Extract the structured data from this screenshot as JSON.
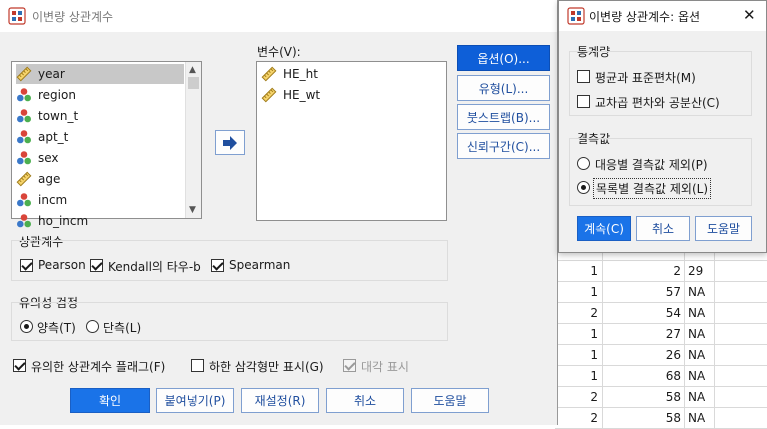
{
  "main_dialog": {
    "title": "이변량 상관계수",
    "variables_label": "변수(V):",
    "source_list": [
      {
        "name": "year",
        "type": "scale",
        "selected": true
      },
      {
        "name": "region",
        "type": "nominal"
      },
      {
        "name": "town_t",
        "type": "nominal"
      },
      {
        "name": "apt_t",
        "type": "nominal"
      },
      {
        "name": "sex",
        "type": "nominal"
      },
      {
        "name": "age",
        "type": "scale"
      },
      {
        "name": "incm",
        "type": "nominal"
      },
      {
        "name": "ho_incm",
        "type": "nominal"
      }
    ],
    "target_list": [
      {
        "name": "HE_ht",
        "type": "scale"
      },
      {
        "name": "HE_wt",
        "type": "scale"
      }
    ],
    "side_buttons": [
      "옵션(O)...",
      "유형(L)...",
      "붓스트랩(B)...",
      "신뢰구간(C)..."
    ],
    "correlation_group": {
      "title": "상관계수",
      "pearson": "Pearson",
      "kendall": "Kendall의 타우-b",
      "spearman": "Spearman"
    },
    "significance_group": {
      "title": "유의성 검정",
      "two_tailed": "양측(T)",
      "one_tailed": "단측(L)"
    },
    "flag_label": "유의한 상관계수 플래그(F)",
    "lower_triangle_label": "하한 삼각형만 표시(G)",
    "diagonal_label": "대각 표시",
    "bottom_buttons": [
      "확인",
      "붙여넣기(P)",
      "재설정(R)",
      "취소",
      "도움말"
    ]
  },
  "options_dialog": {
    "title": "이변량 상관계수: 옵션",
    "close_glyph": "✕",
    "stats_group": {
      "title": "통계량",
      "mean_sd": "평균과 표준편차(M)",
      "cross_product": "교차곱 편차와 공분산(C)"
    },
    "missing_group": {
      "title": "결측값",
      "pairwise": "대응별 결측값 제외(P)",
      "listwise": "목록별 결측값 제외(L)"
    },
    "buttons": [
      "계속(C)",
      "취소",
      "도움말"
    ]
  },
  "data_grid": {
    "rows": [
      [
        "",
        "",
        ""
      ],
      [
        "1",
        "2",
        "29"
      ],
      [
        "1",
        "57",
        "NA"
      ],
      [
        "2",
        "54",
        "NA"
      ],
      [
        "1",
        "27",
        "NA"
      ],
      [
        "1",
        "26",
        "NA"
      ],
      [
        "1",
        "68",
        "NA"
      ],
      [
        "2",
        "58",
        "NA"
      ],
      [
        "2",
        "58",
        "NA"
      ]
    ]
  },
  "colors": {
    "accent": "#1a73e8",
    "dialog_bg": "#f0f0f0"
  }
}
